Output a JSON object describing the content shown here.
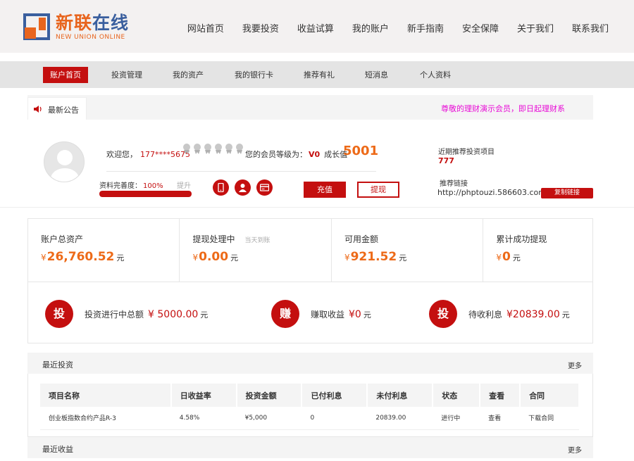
{
  "header": {
    "logo_cn_1": "新联",
    "logo_cn_2": "在线",
    "logo_en": "NEW UNION ONLINE",
    "nav": [
      "网站首页",
      "我要投资",
      "收益试算",
      "我的账户",
      "新手指南",
      "安全保障",
      "关于我们",
      "联系我们"
    ]
  },
  "subnav": [
    "账户首页",
    "投资管理",
    "我的资产",
    "我的银行卡",
    "推荐有礼",
    "短消息",
    "个人资料"
  ],
  "notice": {
    "label": "最新公告",
    "message": "尊敬的理财演示会员，即日起理财系"
  },
  "profile": {
    "welcome": "欢迎您，",
    "phone": "177****5675",
    "level_label": "您的会员等级为：",
    "level": "V0",
    "growth_label": "成长值",
    "growth": "5001",
    "completeness_label": "资料完善度：",
    "completeness": "100%",
    "completeness_value": 100,
    "promote": "提升",
    "recharge": "充值",
    "withdraw": "提现",
    "recent_project_label": "近期推荐投资项目",
    "recent_project": "777",
    "referral_label": "推荐链接",
    "referral_link": "http://phptouzi.586603.com...",
    "copy_link": "复制链接"
  },
  "stats": [
    {
      "label": "账户总资产",
      "sub": "",
      "yen": "¥",
      "value": "26,760.52",
      "unit": "元"
    },
    {
      "label": "提现处理中",
      "sub": "当天到账",
      "yen": "¥",
      "value": "0.00",
      "unit": "元"
    },
    {
      "label": "可用金额",
      "sub": "",
      "yen": "¥",
      "value": "921.52",
      "unit": "元"
    },
    {
      "label": "累计成功提现",
      "sub": "",
      "yen": "¥",
      "value": "0",
      "unit": "元"
    }
  ],
  "earnings": [
    {
      "badge": "投",
      "label": "投资进行中总额",
      "value": "¥ 5000.00",
      "unit": "元"
    },
    {
      "badge": "赚",
      "label": "赚取收益",
      "value": "¥0",
      "unit": "元"
    },
    {
      "badge": "投",
      "label": "待收利息",
      "value": "¥20839.00",
      "unit": "元"
    }
  ],
  "recent_investments": {
    "title": "最近投资",
    "more": "更多",
    "columns": [
      "项目名称",
      "日收益率",
      "投资金额",
      "已付利息",
      "未付利息",
      "状态",
      "查看",
      "合同"
    ],
    "rows": [
      [
        "创业板指数合约产品R-3",
        "4.58%",
        "¥5,000",
        "0",
        "20839.00",
        "进行中",
        "查看",
        "下载合同"
      ]
    ]
  },
  "recent_earnings": {
    "title": "最近收益",
    "more": "更多"
  },
  "colors": {
    "brand_red": "#c40f0f",
    "accent_orange": "#ed6a18",
    "notice_pink": "#e80bd6",
    "logo_blue": "#3a5f9e"
  }
}
